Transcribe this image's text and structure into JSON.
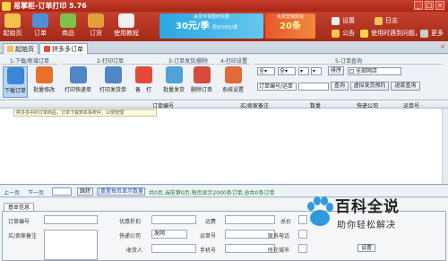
{
  "app": {
    "title": "易掌柜-订单打印 5.76",
    "minimize": "_",
    "maximize": "□",
    "close": "×"
  },
  "mainbar": {
    "buttons": [
      {
        "label": "起始页",
        "color": "#f2c14e"
      },
      {
        "label": "订单",
        "color": "#4f8fd8"
      },
      {
        "label": "商品",
        "color": "#7cc24a"
      },
      {
        "label": "订货",
        "color": "#e3a03a"
      },
      {
        "label": "使用教程",
        "color": "#f0f0f0"
      }
    ],
    "banner1": {
      "small": "会员专享限时优惠",
      "big": "30元/季",
      "tag": "原价50元/季"
    },
    "banner2": {
      "small": "免费营销短信",
      "big": "20条"
    },
    "right_tools": [
      {
        "label": "设置",
        "color": "#eeeeee"
      },
      {
        "label": "日志",
        "color": "#f4c45a"
      },
      {
        "label": "公告",
        "color": "#f4c45a"
      },
      {
        "label": "使用时遇到问题，请",
        "color": "#ffd24a"
      },
      {
        "label": "更多",
        "color": "#cccccc"
      }
    ]
  },
  "tabs": [
    {
      "label": "起始页",
      "active": false
    },
    {
      "label": "拼多多订单",
      "active": true,
      "close": "×"
    }
  ],
  "ribbon": {
    "groups": [
      "1-下载/新增订单",
      "2-打印订单",
      "3-订单发货/删除",
      "4-打印设置",
      "5-订单查询"
    ],
    "buttons": [
      {
        "label": "下载订单",
        "color": "#3b86d8",
        "selected": true
      },
      {
        "label": "批量修改",
        "color": "#e8702c",
        "selected": false
      },
      {
        "label": "打印快递单",
        "color": "#4f86c6",
        "selected": false
      },
      {
        "label": "打印发货单",
        "color": "#4f86c6",
        "selected": false
      },
      {
        "label": "备　打",
        "color": "#e34a3a",
        "selected": false
      },
      {
        "label": "批量发货",
        "color": "#4fa3d8",
        "selected": false
      },
      {
        "label": "删除订单",
        "color": "#d84a3a",
        "selected": false
      },
      {
        "label": "系统设置",
        "color": "#e06a3a",
        "selected": false
      }
    ],
    "query": {
      "sel1": "全▾",
      "sel2": "全▾",
      "sel3": "▾",
      "sort_btn": "排序",
      "shop": "全部网店",
      "field_sel": "订单编号/运单",
      "query_btn": "查询",
      "virtual_btn": "虚拟发货预约",
      "refund_btn": "退款查询"
    }
  },
  "grid": {
    "columns": [
      "订单编号",
      "买/卖家备注",
      "数量",
      "快递公司",
      "运单号"
    ],
    "notice": "拼多多中的订单商品，订单下载到本系统中，以便管理"
  },
  "pager": {
    "prev": "上一页",
    "next": "下一页",
    "jump": "跳转",
    "show": "重置每页显示数量",
    "info": "共0页,当前第0页,每页显示2000条订单,总共0条订单"
  },
  "detail": {
    "tab": "基本信息",
    "labels": {
      "order_no": "订单编号",
      "remark": "买/卖家备注",
      "discount": "优惠折扣",
      "express": "快递公司",
      "receiver": "收货人",
      "freight": "运费",
      "waybill": "运单号",
      "phone": "手机号",
      "total": "总价",
      "contact": "联系电话",
      "city": "所在城市",
      "payment": "支付",
      "set_btn": "设置",
      "express_val": "发网"
    }
  },
  "watermark": {
    "line1": "百科全说",
    "line2": "助你轻松解决"
  }
}
